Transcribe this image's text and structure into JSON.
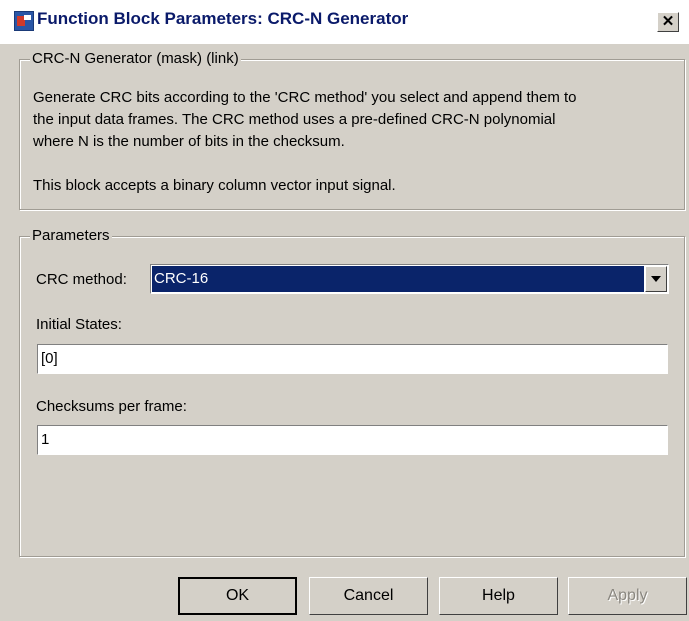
{
  "window": {
    "title": "Function Block Parameters: CRC-N Generator",
    "close_symbol": "✕"
  },
  "description_group": {
    "legend": "CRC-N Generator (mask) (link)",
    "lines": [
      "Generate CRC bits according to the 'CRC method' you select and append them to",
      "the input data frames. The CRC method uses a pre-defined CRC-N polynomial",
      "where N is the number of bits in the checksum."
    ],
    "note": "This block accepts a binary column vector input signal."
  },
  "parameters": {
    "legend": "Parameters",
    "crc_method_label": "CRC method:",
    "crc_method_value": "CRC-16",
    "initial_states_label": "Initial States:",
    "initial_states_value": "[0]",
    "checksums_label": "Checksums per frame:",
    "checksums_value": "1"
  },
  "buttons": {
    "ok": "OK",
    "cancel": "Cancel",
    "help": "Help",
    "apply": "Apply"
  },
  "icons": {
    "app": "simulink-block-icon",
    "close": "close-icon",
    "dropdown": "chevron-down-icon"
  }
}
